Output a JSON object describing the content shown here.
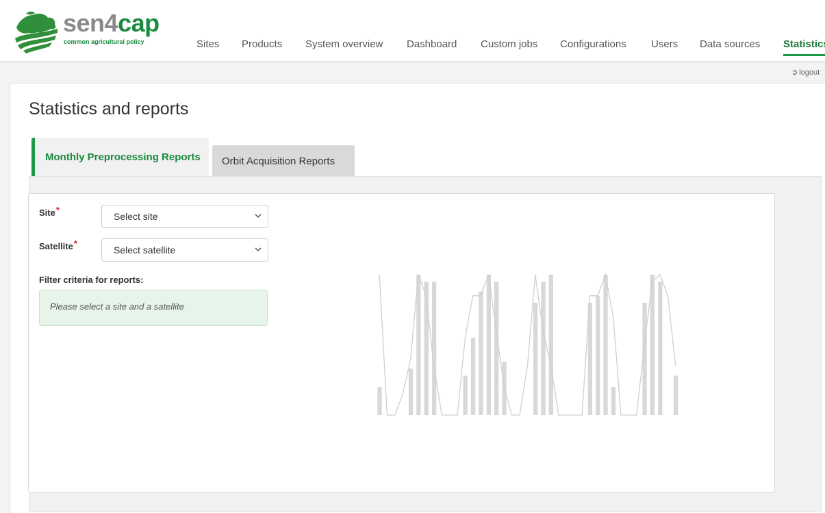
{
  "brand": {
    "name_part1": "sen4",
    "name_part2": "cap",
    "tagline": "common agricultural policy"
  },
  "nav": {
    "items": [
      {
        "label": "Sites"
      },
      {
        "label": "Products"
      },
      {
        "label": "System overview"
      },
      {
        "label": "Dashboard"
      },
      {
        "label": "Custom jobs"
      },
      {
        "label": "Configurations"
      },
      {
        "label": "Users"
      },
      {
        "label": "Data sources"
      },
      {
        "label": "Statistics",
        "active": true
      }
    ]
  },
  "logout": {
    "label": "logout",
    "icon": "sign-out-icon"
  },
  "page": {
    "title": "Statistics and reports"
  },
  "tabs": [
    {
      "label": "Monthly Preprocessing Reports",
      "active": true
    },
    {
      "label": "Orbit Acquisition Reports",
      "active": false
    }
  ],
  "form": {
    "site": {
      "label": "Site",
      "required_mark": "*",
      "value": "Select site"
    },
    "satellite": {
      "label": "Satellite",
      "required_mark": "*",
      "value": "Select satellite"
    },
    "filter_title": "Filter criteria for reports:",
    "notice": "Please select a site and a satellite"
  },
  "colors": {
    "accent": "#1a9a45",
    "placeholder_chart": "#d8d8d8",
    "notice_bg": "#e6f4ea",
    "required": "#d9232e"
  },
  "chart_data": {
    "type": "bar",
    "placeholder": true,
    "ylim": [
      0,
      100
    ],
    "values": [
      20,
      0,
      0,
      0,
      33,
      100,
      95,
      95,
      0,
      0,
      0,
      28,
      55,
      88,
      100,
      95,
      38,
      0,
      0,
      0,
      80,
      95,
      100,
      0,
      0,
      0,
      0,
      80,
      85,
      100,
      20,
      0,
      0,
      0,
      80,
      100,
      95,
      0,
      28
    ],
    "line": [
      100,
      0,
      0,
      15,
      40,
      100,
      85,
      35,
      0,
      0,
      0,
      55,
      85,
      85,
      100,
      60,
      20,
      0,
      0,
      35,
      100,
      60,
      35,
      0,
      0,
      0,
      0,
      85,
      85,
      100,
      70,
      0,
      0,
      0,
      50,
      95,
      100,
      85,
      35
    ]
  }
}
